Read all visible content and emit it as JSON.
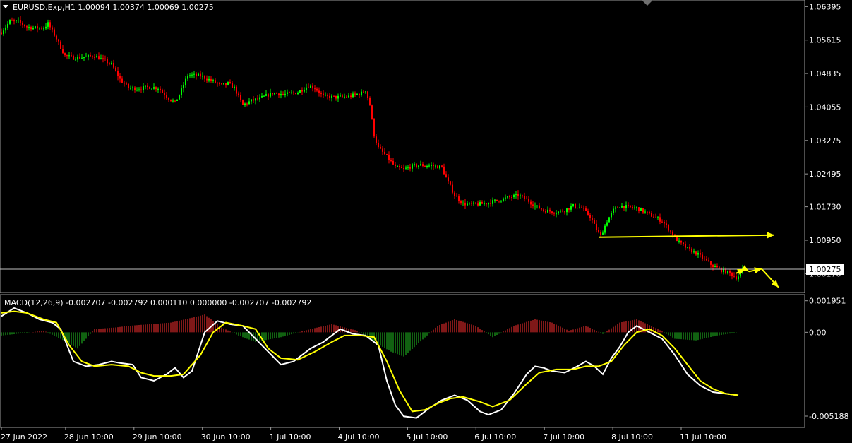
{
  "chart_data": {
    "type": "candlestick",
    "symbol_header": "EURUSD.Exp,H1  1.00094 1.00374 1.00069 1.00275",
    "price_axis": {
      "ticks": [
        "1.06395",
        "1.05615",
        "1.04835",
        "1.04055",
        "1.03275",
        "1.02495",
        "1.01730",
        "1.00950",
        "1.00170"
      ],
      "current_price_label": "1.00275",
      "range": [
        0.9983,
        1.0645
      ]
    },
    "time_axis": {
      "ticks": [
        "27 Jun 2022",
        "28 Jun 10:00",
        "29 Jun 10:00",
        "30 Jun 10:00",
        "1 Jul 10:00",
        "4 Jul 10:00",
        "5 Jul 10:00",
        "6 Jul 10:00",
        "7 Jul 10:00",
        "8 Jul 10:00",
        "11 Jul 10:00"
      ]
    },
    "price_path": [
      [
        0,
        1.058
      ],
      [
        4,
        1.0605
      ],
      [
        8,
        1.0605
      ],
      [
        12,
        1.0592
      ],
      [
        16,
        1.059
      ],
      [
        20,
        1.059
      ],
      [
        22,
        1.06
      ],
      [
        26,
        1.0565
      ],
      [
        30,
        1.0525
      ],
      [
        34,
        1.052
      ],
      [
        40,
        1.0522
      ],
      [
        44,
        1.0525
      ],
      [
        48,
        1.0515
      ],
      [
        52,
        1.0505
      ],
      [
        56,
        1.047
      ],
      [
        60,
        1.045
      ],
      [
        64,
        1.0448
      ],
      [
        70,
        1.0452
      ],
      [
        74,
        1.045
      ],
      [
        78,
        1.043
      ],
      [
        82,
        1.0415
      ],
      [
        85,
        1.0445
      ],
      [
        88,
        1.048
      ],
      [
        94,
        1.0478
      ],
      [
        100,
        1.0465
      ],
      [
        104,
        1.0455
      ],
      [
        107,
        1.046
      ],
      [
        110,
        1.045
      ],
      [
        114,
        1.041
      ],
      [
        118,
        1.042
      ],
      [
        122,
        1.0425
      ],
      [
        128,
        1.0438
      ],
      [
        134,
        1.0435
      ],
      [
        140,
        1.044
      ],
      [
        145,
        1.0455
      ],
      [
        148,
        1.045
      ],
      [
        152,
        1.043
      ],
      [
        158,
        1.0428
      ],
      [
        164,
        1.043
      ],
      [
        170,
        1.0438
      ],
      [
        172,
        1.0445
      ],
      [
        174,
        1.041
      ],
      [
        176,
        1.034
      ],
      [
        178,
        1.031
      ],
      [
        182,
        1.029
      ],
      [
        186,
        1.0265
      ],
      [
        190,
        1.026
      ],
      [
        194,
        1.0268
      ],
      [
        198,
        1.027
      ],
      [
        204,
        1.0268
      ],
      [
        208,
        1.0265
      ],
      [
        210,
        1.024
      ],
      [
        214,
        1.02
      ],
      [
        218,
        1.018
      ],
      [
        222,
        1.0178
      ],
      [
        228,
        1.018
      ],
      [
        232,
        1.0185
      ],
      [
        236,
        1.019
      ],
      [
        240,
        1.0195
      ],
      [
        244,
        1.02
      ],
      [
        248,
        1.019
      ],
      [
        252,
        1.0175
      ],
      [
        256,
        1.0165
      ],
      [
        262,
        1.016
      ],
      [
        266,
        1.0165
      ],
      [
        270,
        1.0175
      ],
      [
        274,
        1.017
      ],
      [
        278,
        1.015
      ],
      [
        281,
        1.012
      ],
      [
        283,
        1.0105
      ],
      [
        286,
        1.014
      ],
      [
        289,
        1.0165
      ],
      [
        292,
        1.0175
      ],
      [
        296,
        1.0172
      ],
      [
        300,
        1.017
      ],
      [
        304,
        1.016
      ],
      [
        308,
        1.015
      ],
      [
        312,
        1.014
      ],
      [
        316,
        1.0115
      ],
      [
        320,
        1.009
      ],
      [
        324,
        1.0075
      ],
      [
        328,
        1.0065
      ],
      [
        332,
        1.005
      ],
      [
        336,
        1.0035
      ],
      [
        340,
        1.0025
      ],
      [
        344,
        1.0018
      ],
      [
        347,
        1.0008
      ],
      [
        349,
        1.0015
      ],
      [
        350,
        1.00275
      ]
    ],
    "annotations": {
      "horizontal_arrow": {
        "from": [
          282,
          1.0102
        ],
        "to": [
          365,
          1.0107
        ]
      },
      "zigzag_arrows": [
        {
          "from": [
            347,
            1.0018
          ],
          "to": [
            351,
            1.0028
          ]
        },
        {
          "from": [
            351,
            1.0028
          ],
          "to": [
            353,
            1.0022
          ]
        },
        {
          "from": [
            353,
            1.0022
          ],
          "to": [
            359,
            1.0028
          ]
        },
        {
          "from": [
            359,
            1.0028
          ],
          "to": [
            367,
            0.9985
          ]
        }
      ]
    },
    "macd": {
      "header": "MACD(12,26,9) -0.002707 -0.002792 0.000110 0.000000 -0.002707 -0.002792",
      "axis_ticks": [
        "0.001951",
        "0.00",
        "-0.005188"
      ],
      "range": [
        -0.0058,
        0.0022
      ],
      "main_line_path": [
        [
          0,
          0.001
        ],
        [
          6,
          0.0015
        ],
        [
          12,
          0.0012
        ],
        [
          18,
          0.0008
        ],
        [
          24,
          0.0006
        ],
        [
          28,
          0.0002
        ],
        [
          34,
          -0.0018
        ],
        [
          40,
          -0.0021
        ],
        [
          46,
          -0.002
        ],
        [
          52,
          -0.0018
        ],
        [
          56,
          -0.0019
        ],
        [
          62,
          -0.002
        ],
        [
          66,
          -0.0028
        ],
        [
          72,
          -0.003
        ],
        [
          78,
          -0.0026
        ],
        [
          82,
          -0.0022
        ],
        [
          86,
          -0.0028
        ],
        [
          90,
          -0.0024
        ],
        [
          96,
          0.0
        ],
        [
          102,
          0.0007
        ],
        [
          108,
          0.0005
        ],
        [
          114,
          0.0004
        ],
        [
          120,
          -0.0004
        ],
        [
          126,
          -0.0012
        ],
        [
          132,
          -0.002
        ],
        [
          138,
          -0.0018
        ],
        [
          146,
          -0.001
        ],
        [
          152,
          -0.0006
        ],
        [
          156,
          -0.0002
        ],
        [
          160,
          0.0002
        ],
        [
          166,
          -0.0001
        ],
        [
          172,
          -0.0002
        ],
        [
          178,
          -0.0008
        ],
        [
          182,
          -0.003
        ],
        [
          186,
          -0.0045
        ],
        [
          190,
          -0.0052
        ],
        [
          196,
          -0.0053
        ],
        [
          202,
          -0.0047
        ],
        [
          208,
          -0.0042
        ],
        [
          214,
          -0.0039
        ],
        [
          220,
          -0.0042
        ],
        [
          226,
          -0.0049
        ],
        [
          230,
          -0.0051
        ],
        [
          236,
          -0.0048
        ],
        [
          242,
          -0.0038
        ],
        [
          248,
          -0.0026
        ],
        [
          252,
          -0.0021
        ],
        [
          256,
          -0.0022
        ],
        [
          260,
          -0.0024
        ],
        [
          266,
          -0.0025
        ],
        [
          272,
          -0.0021
        ],
        [
          276,
          -0.0018
        ],
        [
          280,
          -0.0021
        ],
        [
          284,
          -0.0026
        ],
        [
          288,
          -0.0016
        ],
        [
          292,
          -0.0009
        ],
        [
          296,
          0.0
        ],
        [
          300,
          0.0004
        ],
        [
          306,
          0.0
        ],
        [
          312,
          -0.0004
        ],
        [
          318,
          -0.0014
        ],
        [
          324,
          -0.0026
        ],
        [
          330,
          -0.0033
        ],
        [
          336,
          -0.0037
        ],
        [
          342,
          -0.0038
        ],
        [
          348,
          -0.0039
        ]
      ],
      "signal_line_path": [
        [
          0,
          0.0012
        ],
        [
          6,
          0.0013
        ],
        [
          12,
          0.0012
        ],
        [
          20,
          0.0008
        ],
        [
          26,
          0.0006
        ],
        [
          32,
          -0.0008
        ],
        [
          38,
          -0.0018
        ],
        [
          44,
          -0.0021
        ],
        [
          52,
          -0.002
        ],
        [
          60,
          -0.0021
        ],
        [
          66,
          -0.0025
        ],
        [
          72,
          -0.0027
        ],
        [
          80,
          -0.0027
        ],
        [
          86,
          -0.0026
        ],
        [
          94,
          -0.0014
        ],
        [
          100,
          0.0
        ],
        [
          106,
          0.0006
        ],
        [
          114,
          0.0004
        ],
        [
          120,
          0.0002
        ],
        [
          126,
          -0.001
        ],
        [
          132,
          -0.0016
        ],
        [
          140,
          -0.0017
        ],
        [
          148,
          -0.0012
        ],
        [
          156,
          -0.0006
        ],
        [
          162,
          -0.0002
        ],
        [
          170,
          -0.0002
        ],
        [
          176,
          -0.0003
        ],
        [
          182,
          -0.0018
        ],
        [
          188,
          -0.0036
        ],
        [
          194,
          -0.0049
        ],
        [
          200,
          -0.0048
        ],
        [
          206,
          -0.0044
        ],
        [
          212,
          -0.0041
        ],
        [
          218,
          -0.004
        ],
        [
          226,
          -0.0043
        ],
        [
          232,
          -0.0046
        ],
        [
          240,
          -0.0042
        ],
        [
          248,
          -0.0032
        ],
        [
          254,
          -0.0025
        ],
        [
          262,
          -0.0023
        ],
        [
          270,
          -0.0023
        ],
        [
          276,
          -0.0021
        ],
        [
          282,
          -0.0021
        ],
        [
          288,
          -0.0018
        ],
        [
          294,
          -0.0008
        ],
        [
          300,
          0.0
        ],
        [
          306,
          0.0002
        ],
        [
          312,
          -0.0002
        ],
        [
          318,
          -0.001
        ],
        [
          324,
          -0.002
        ],
        [
          330,
          -0.003
        ],
        [
          336,
          -0.0035
        ],
        [
          342,
          -0.0038
        ],
        [
          348,
          -0.0039
        ]
      ],
      "histogram_path": [
        [
          0,
          -0.0002
        ],
        [
          14,
          0.0
        ],
        [
          20,
          0.0001
        ],
        [
          28,
          -0.0004
        ],
        [
          36,
          -0.001
        ],
        [
          44,
          0.0002
        ],
        [
          54,
          0.0003
        ],
        [
          60,
          0.0004
        ],
        [
          70,
          0.0005
        ],
        [
          80,
          0.0006
        ],
        [
          90,
          0.0009
        ],
        [
          96,
          0.0011
        ],
        [
          104,
          0.0003
        ],
        [
          112,
          -0.0002
        ],
        [
          120,
          -0.0006
        ],
        [
          132,
          -0.0003
        ],
        [
          146,
          0.0002
        ],
        [
          156,
          0.0005
        ],
        [
          168,
          0.0001
        ],
        [
          176,
          -0.0006
        ],
        [
          184,
          -0.0012
        ],
        [
          190,
          -0.0015
        ],
        [
          196,
          -0.0008
        ],
        [
          206,
          0.0004
        ],
        [
          214,
          0.0008
        ],
        [
          224,
          0.0004
        ],
        [
          232,
          -0.0003
        ],
        [
          242,
          0.0004
        ],
        [
          252,
          0.0008
        ],
        [
          260,
          0.0006
        ],
        [
          268,
          0.0001
        ],
        [
          276,
          0.0004
        ],
        [
          284,
          -0.0001
        ],
        [
          292,
          0.0006
        ],
        [
          300,
          0.0008
        ],
        [
          310,
          0.0002
        ],
        [
          318,
          -0.0004
        ],
        [
          328,
          -0.0005
        ],
        [
          338,
          -0.0002
        ],
        [
          348,
          0.0
        ]
      ]
    }
  }
}
